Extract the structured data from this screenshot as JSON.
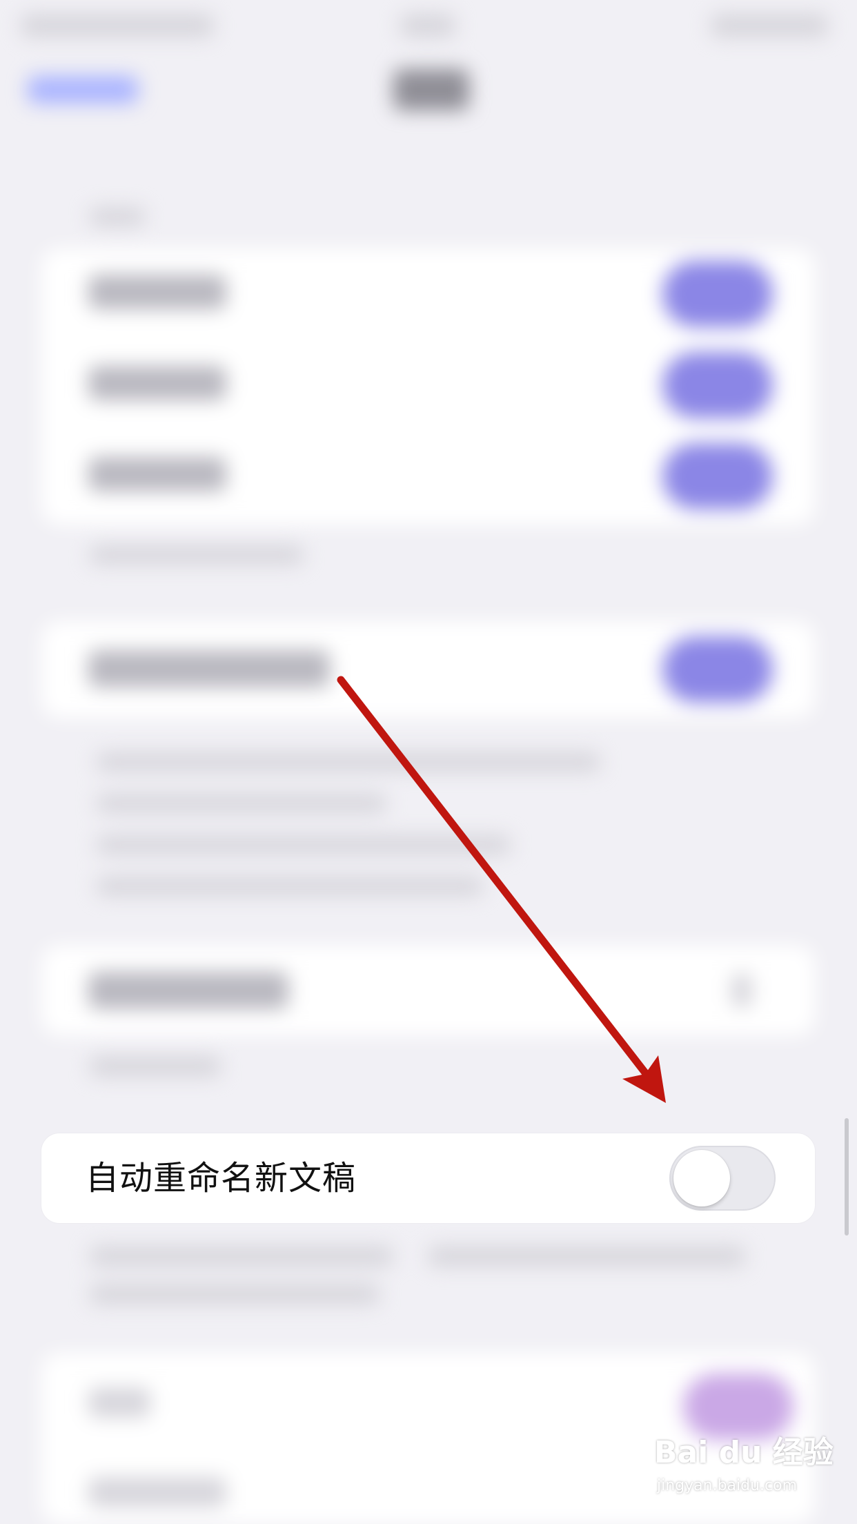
{
  "settings": {
    "rename_new_drafts_label": "自动重命名新文稿",
    "rename_new_drafts_enabled": false
  },
  "colors": {
    "page_background": "#f1f0f5",
    "toggle_on": "#8b86e6",
    "arrow": "#c0160f"
  },
  "watermark": {
    "logo_text": "Bai du 经验",
    "url": "jingyan.baidu.com"
  }
}
